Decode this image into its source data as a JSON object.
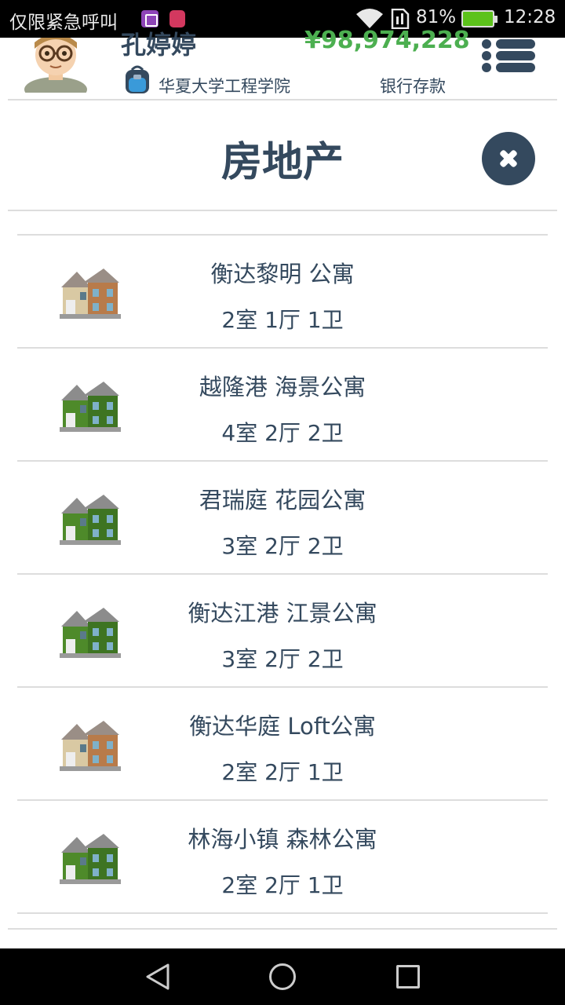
{
  "status_bar": {
    "carrier_text": "仅限紧急呼叫",
    "battery_percent": "81%",
    "time": "12:28",
    "battery_level": 0.81,
    "icons": [
      "gallery-icon",
      "notification-app-icon",
      "wifi-icon",
      "sim-icon",
      "battery-icon"
    ]
  },
  "header": {
    "player_name": "孔婷婷",
    "money": "¥98,974,228",
    "school": "华夏大学工程学院",
    "bank_label": "银行存款"
  },
  "page": {
    "title": "房地产"
  },
  "properties": [
    {
      "name": "衡达黎明 公寓",
      "rooms": "2室 1厅 1卫",
      "image": "beige-house-icon"
    },
    {
      "name": "越隆港 海景公寓",
      "rooms": "4室 2厅 2卫",
      "image": "green-house-icon"
    },
    {
      "name": "君瑞庭 花园公寓",
      "rooms": "3室 2厅 2卫",
      "image": "green-house-icon"
    },
    {
      "name": "衡达江港 江景公寓",
      "rooms": "3室 2厅 2卫",
      "image": "green-house-icon"
    },
    {
      "name": "衡达华庭 Loft公寓",
      "rooms": "2室 2厅 1卫",
      "image": "beige-house-icon"
    },
    {
      "name": "林海小镇 森林公寓",
      "rooms": "2室 2厅 1卫",
      "image": "green-house-icon"
    }
  ],
  "colors": {
    "primary": "#34495e",
    "money": "#4caf50",
    "divider": "#dddddd"
  }
}
